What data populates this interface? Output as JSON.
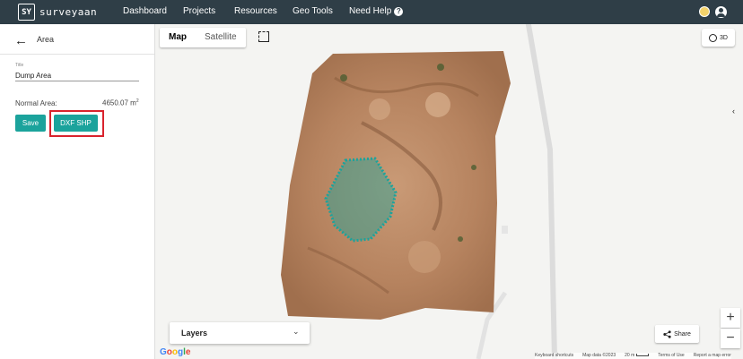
{
  "app": {
    "logo_mark": "SY",
    "logo_text": "surveyaan"
  },
  "nav": {
    "dashboard": "Dashboard",
    "projects": "Projects",
    "resources": "Resources",
    "geo_tools": "Geo Tools",
    "need_help": "Need Help",
    "help_glyph": "?"
  },
  "sidebar": {
    "back_glyph": "←",
    "title": "Area",
    "field_label": "Title",
    "field_value": "Dump Area",
    "area_label": "Normal Area:",
    "area_value": "4650.07 m",
    "area_unit_sup": "2",
    "save_label": "Save",
    "dxf_label": "DXF SHP",
    "accent_color": "#1ba39c",
    "highlight_color": "#d9232d"
  },
  "map": {
    "type_map": "Map",
    "type_satellite": "Satellite",
    "btn_3d": "3D",
    "collapse_glyph": "‹",
    "layers_label": "Layers",
    "layers_chevron": "⌄",
    "share_label": "Share",
    "zoom_in": "+",
    "zoom_out": "−",
    "google_letters": [
      "G",
      "o",
      "o",
      "g",
      "l",
      "e"
    ],
    "attribution": {
      "shortcuts": "Keyboard shortcuts",
      "map_data": "Map data ©2023",
      "scale": "20 m",
      "terms": "Terms of Use",
      "report": "Report a map error"
    },
    "polygon_color": "#1ba39c"
  }
}
